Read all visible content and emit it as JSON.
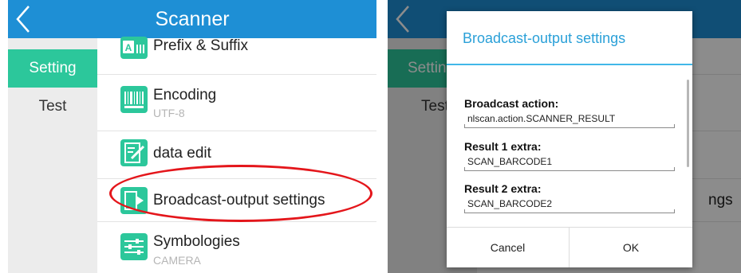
{
  "left": {
    "title": "Scanner",
    "sidebar": [
      {
        "label": "Setting",
        "active": true
      },
      {
        "label": "Test",
        "active": false
      }
    ],
    "items": [
      {
        "icon": "prefix-suffix-icon",
        "title": "Prefix & Suffix",
        "subtitle": ""
      },
      {
        "icon": "barcode-icon",
        "title": "Encoding",
        "subtitle": "UTF-8"
      },
      {
        "icon": "edit-icon",
        "title": "data edit",
        "subtitle": ""
      },
      {
        "icon": "broadcast-output-icon",
        "title": "Broadcast-output settings",
        "subtitle": ""
      },
      {
        "icon": "sliders-icon",
        "title": "Symbologies",
        "subtitle": "CAMERA"
      }
    ],
    "highlight_color": "#e4161b"
  },
  "right": {
    "background": {
      "sidebar": [
        "Settin",
        "Test"
      ],
      "peek_text": "ngs"
    },
    "dialog": {
      "title": "Broadcast-output settings",
      "fields": [
        {
          "label": "Broadcast action:",
          "value": "nlscan.action.SCANNER_RESULT"
        },
        {
          "label": "Result 1 extra:",
          "value": "SCAN_BARCODE1"
        },
        {
          "label": "Result 2 extra:",
          "value": "SCAN_BARCODE2"
        }
      ],
      "cancel_label": "Cancel",
      "ok_label": "OK"
    }
  },
  "colors": {
    "topbar": "#1e8fd5",
    "accent": "#2cc79b",
    "dialog_title": "#2aa0d8"
  }
}
